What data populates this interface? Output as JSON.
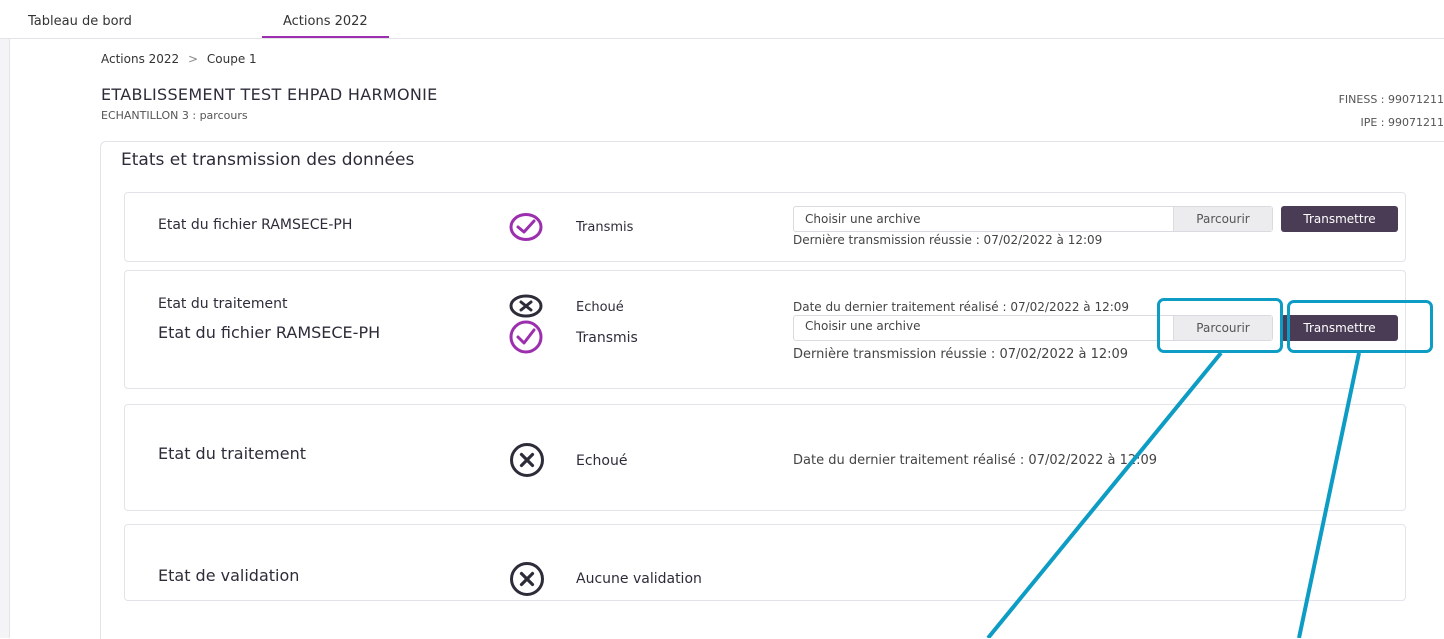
{
  "nav": {
    "tabs": [
      {
        "label": "Tableau de bord"
      },
      {
        "label": "Actions 2022"
      }
    ]
  },
  "breadcrumb": {
    "root": "Actions 2022",
    "separator": ">",
    "current": "Coupe 1"
  },
  "etablissement": {
    "name": "ETABLISSEMENT TEST EHPAD HARMONIE",
    "subtitle": "ECHANTILLON 3 : parcours",
    "finess": "FINESS : 99071211",
    "ipe": "IPE : 99071211"
  },
  "panel": {
    "title": "Etats et transmission des données"
  },
  "card1": {
    "label": "Etat du fichier RAMSECE-PH",
    "status": "Transmis",
    "input_placeholder": "Choisir une archive",
    "browse_label": "Parcourir",
    "send_label": "Transmettre",
    "last": "Dernière transmission réussie : 07/02/2022 à 12:09"
  },
  "card2": {
    "label_back": "Etat du traitement",
    "status_back": "Echoué",
    "info_back": "Date du dernier traitement réalisé : 07/02/2022 à 12:09",
    "label_front": "Etat du fichier RAMSECE-PH",
    "status_front": "Transmis",
    "input_placeholder": "Choisir une archive",
    "browse_label": "Parcourir",
    "send_label": "Transmettre",
    "last": "Dernière transmission réussie : 07/02/2022 à 12:09"
  },
  "card3": {
    "label": "Etat du traitement",
    "status": "Echoué",
    "info": "Date du dernier traitement réalisé : 07/02/2022 à 12:09"
  },
  "card4": {
    "label": "Etat de validation",
    "status": "Aucune validation"
  },
  "icons": {
    "success": "check-circle-icon",
    "failure": "x-circle-icon"
  },
  "colors": {
    "accent": "#9b2fae",
    "button": "#4b3c55",
    "highlight": "#0d9cc4",
    "text": "#2d2d3a"
  }
}
